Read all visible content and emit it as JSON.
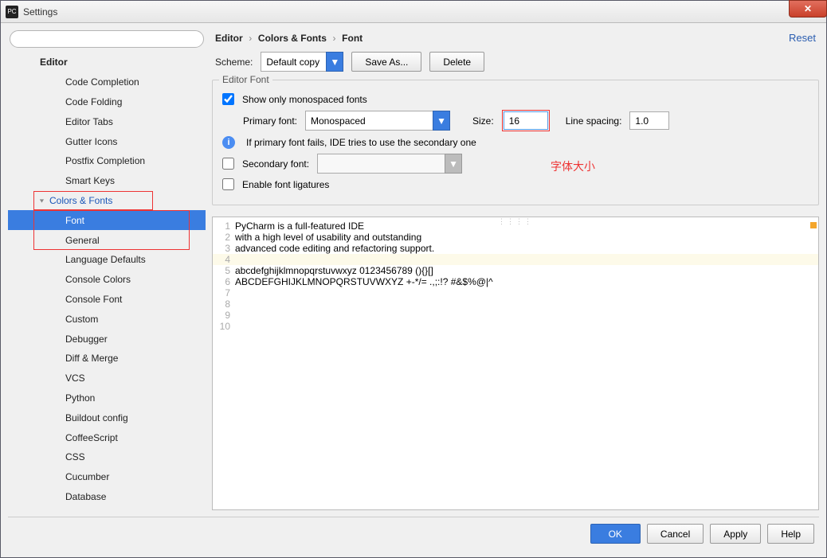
{
  "window": {
    "title": "Settings"
  },
  "close_x": "✕",
  "search": {
    "placeholder": ""
  },
  "sidebar": {
    "editor": "Editor",
    "items": [
      "Code Completion",
      "Code Folding",
      "Editor Tabs",
      "Gutter Icons",
      "Postfix Completion",
      "Smart Keys"
    ],
    "colors_fonts": "Colors & Fonts",
    "font": "Font",
    "after": [
      "General",
      "Language Defaults",
      "Console Colors",
      "Console Font",
      "Custom",
      "Debugger",
      "Diff & Merge",
      "VCS",
      "Python",
      "Buildout config",
      "CoffeeScript",
      "CSS",
      "Cucumber",
      "Database"
    ]
  },
  "breadcrumb": {
    "a": "Editor",
    "b": "Colors & Fonts",
    "c": "Font",
    "sep": "›"
  },
  "reset": "Reset",
  "scheme": {
    "label": "Scheme:",
    "value": "Default copy",
    "save_as": "Save As...",
    "delete": "Delete"
  },
  "fieldset": {
    "title": "Editor Font",
    "show_mono": "Show only monospaced fonts",
    "primary_label": "Primary font:",
    "primary_value": "Monospaced",
    "size_label": "Size:",
    "size_value": "16",
    "spacing_label": "Line spacing:",
    "spacing_value": "1.0",
    "info": "If primary font fails, IDE tries to use the secondary one",
    "secondary_label": "Secondary font:",
    "ligatures": "Enable font ligatures"
  },
  "annotation": "字体大小",
  "preview": {
    "lines": [
      "PyCharm is a full-featured IDE",
      "with a high level of usability and outstanding",
      "advanced code editing and refactoring support.",
      "",
      "abcdefghijklmnopqrstuvwxyz 0123456789 (){}[]",
      "ABCDEFGHIJKLMNOPQRSTUVWXYZ +-*/= .,;:!? #&$%@|^",
      "",
      "",
      "",
      ""
    ],
    "highlight_index": 3
  },
  "footer": {
    "ok": "OK",
    "cancel": "Cancel",
    "apply": "Apply",
    "help": "Help"
  }
}
